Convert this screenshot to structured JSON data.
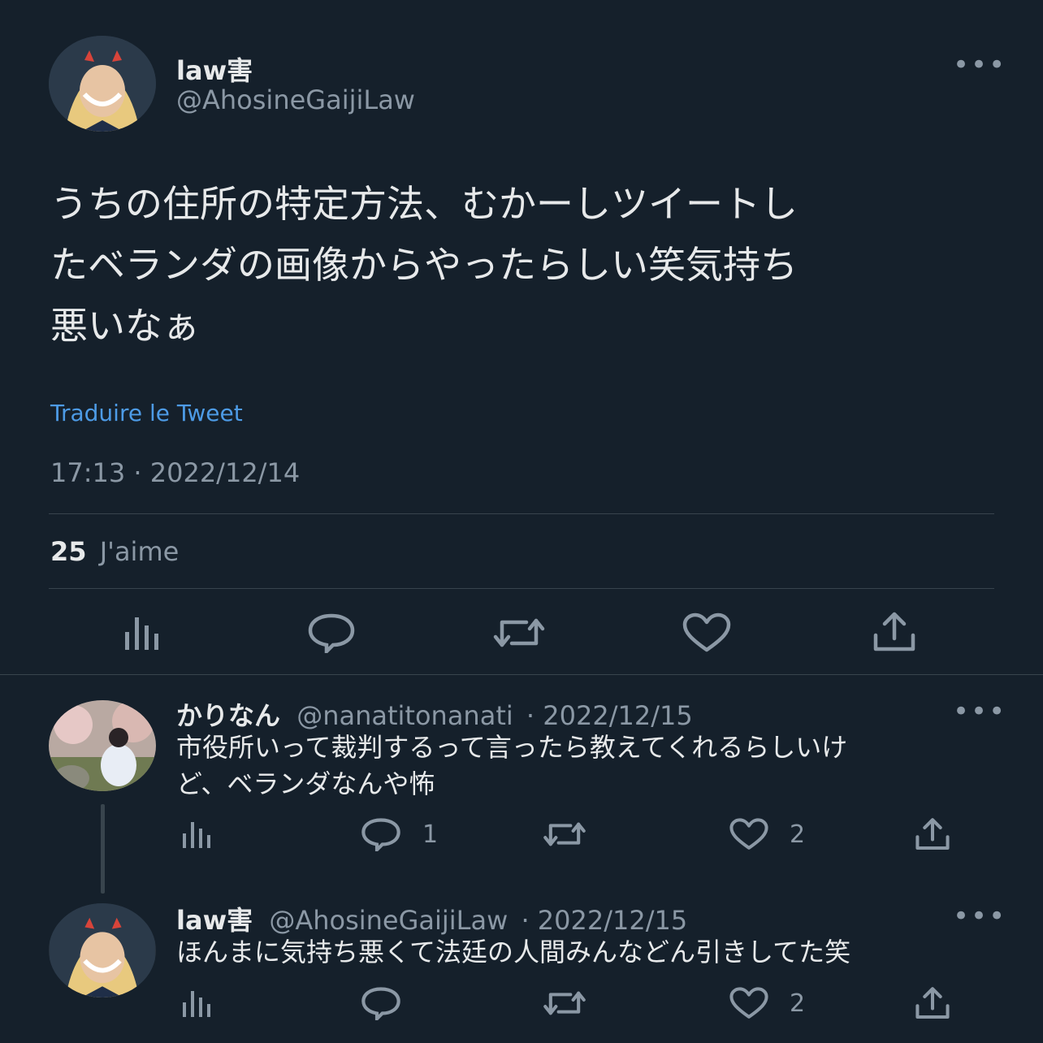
{
  "main_tweet": {
    "display_name": "law害",
    "handle": "@AhosineGaijiLaw",
    "text_lines": [
      "うちの住所の特定方法、むかーしツイートし",
      "たベランダの画像からやったらしい笑気持ち",
      "悪いなぁ"
    ],
    "translate_link": "Traduire le Tweet",
    "timestamp": "17:13 · 2022/12/14",
    "likes_count": "25",
    "likes_label": "J'aime",
    "more": "•••"
  },
  "replies": [
    {
      "display_name": "かりなん",
      "handle": "@nanatitonanati",
      "date": "· 2022/12/15",
      "text_lines": [
        "市役所いって裁判するって言ったら教えてくれるらしいけ",
        "ど、ベランダなんや怖"
      ],
      "reply_count": "1",
      "like_count": "2",
      "more": "•••"
    },
    {
      "display_name": "law害",
      "handle": "@AhosineGaijiLaw",
      "date": "· 2022/12/15",
      "text_lines": [
        "ほんまに気持ち悪くて法廷の人間みんなどん引きしてた笑"
      ],
      "reply_count": "",
      "like_count": "2",
      "more": "•••"
    }
  ],
  "icons": {
    "analytics": "analytics-icon",
    "reply": "reply-icon",
    "retweet": "retweet-icon",
    "like": "like-icon",
    "share": "share-icon"
  },
  "colors": {
    "background": "#15202b",
    "link": "#4d9be6",
    "text": "#e7e9ea",
    "muted": "#8b98a5"
  }
}
